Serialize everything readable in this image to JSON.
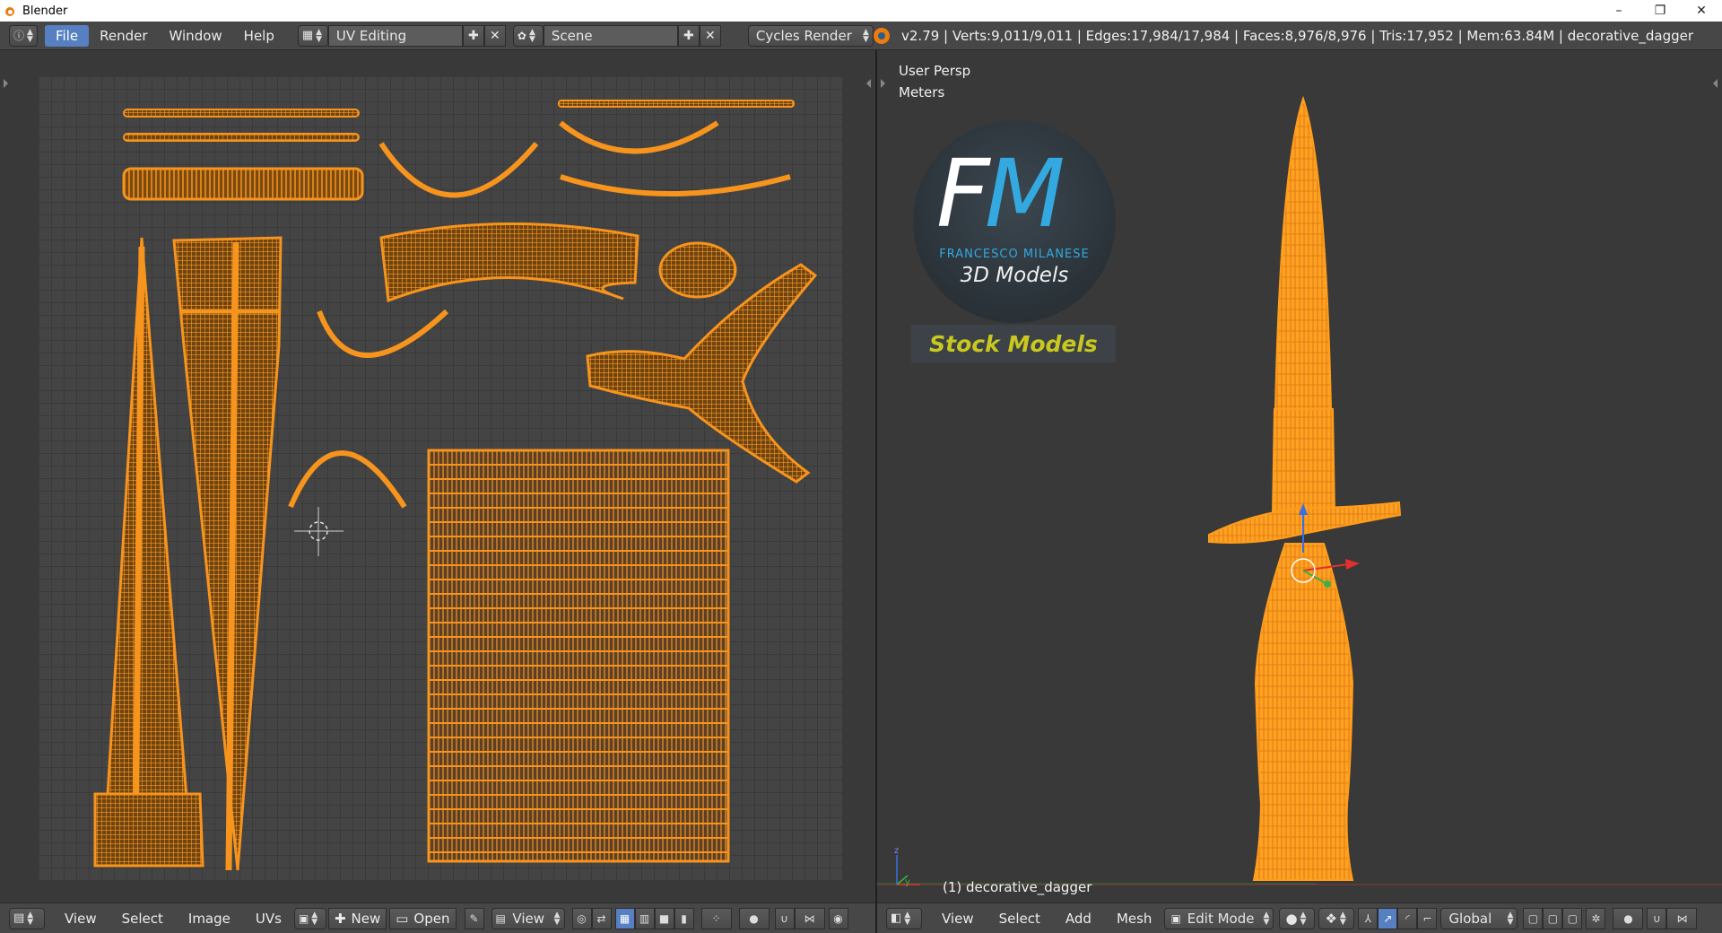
{
  "window": {
    "title": "Blender",
    "controls": {
      "minimize": "–",
      "maximize": "❐",
      "close": "✕"
    }
  },
  "info_header": {
    "menus": [
      "File",
      "Render",
      "Window",
      "Help"
    ],
    "active_menu": "File",
    "screen_layout": "UV Editing",
    "scene": "Scene",
    "render_engine": "Cycles Render",
    "stats": "v2.79 | Verts:9,011/9,011 | Edges:17,984/17,984 | Faces:8,976/8,976 | Tris:17,952 | Mem:63.84M | decorative_dagger"
  },
  "uv_editor": {
    "header_menus": [
      "View",
      "Select",
      "Image",
      "UVs"
    ],
    "new_label": "New",
    "open_label": "Open",
    "view_dropdown": "View"
  },
  "viewport": {
    "view_name": "User Persp",
    "units": "Meters",
    "object_label": "(1) decorative_dagger",
    "header_menus": [
      "View",
      "Select",
      "Add",
      "Mesh"
    ],
    "mode": "Edit Mode",
    "orientation": "Global"
  },
  "watermark": {
    "letters_f": "F",
    "letters_m": "M",
    "brand": "FRANCESCO MILANESE",
    "subtitle": "3D Models",
    "banner": "Stock Models"
  },
  "colors": {
    "mesh_orange": "#f7941d",
    "accent_blue": "#5680c2",
    "logo_blue": "#33a9e0",
    "banner_yellow": "#c8c81e"
  },
  "icons": [
    "info-icon",
    "layout-icon",
    "scene-icon",
    "blender-logo-icon",
    "image-editor-icon",
    "pin-icon",
    "cube-icon",
    "add-icon",
    "close-icon"
  ]
}
